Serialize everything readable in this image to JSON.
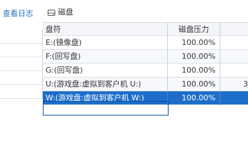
{
  "left": {
    "view_log_link": "查看日志"
  },
  "disk_panel": {
    "title": "磁盘",
    "icon": "disk-drive-icon"
  },
  "table": {
    "columns": [
      "盘符",
      "磁盘压力",
      ""
    ],
    "rows": [
      {
        "drive": "E:(镜像盘)",
        "pressure": "100.00%",
        "extra": ""
      },
      {
        "drive": "F:(回写盘)",
        "pressure": "100.00%",
        "extra": ""
      },
      {
        "drive": "G:(回写盘)",
        "pressure": "100.00%",
        "extra": ""
      },
      {
        "drive": "U:(游戏盘:虚拟到客户机 U:)",
        "pressure": "100.00%",
        "extra": "3"
      },
      {
        "drive": "W:(游戏盘:虚拟到客户机 W:)",
        "pressure": "100.00%",
        "extra": ""
      }
    ],
    "selected_row": 4
  },
  "colors": {
    "link": "#2a73c5",
    "selection": "#1d6ec9",
    "header_bg": "#f3f5f8"
  }
}
